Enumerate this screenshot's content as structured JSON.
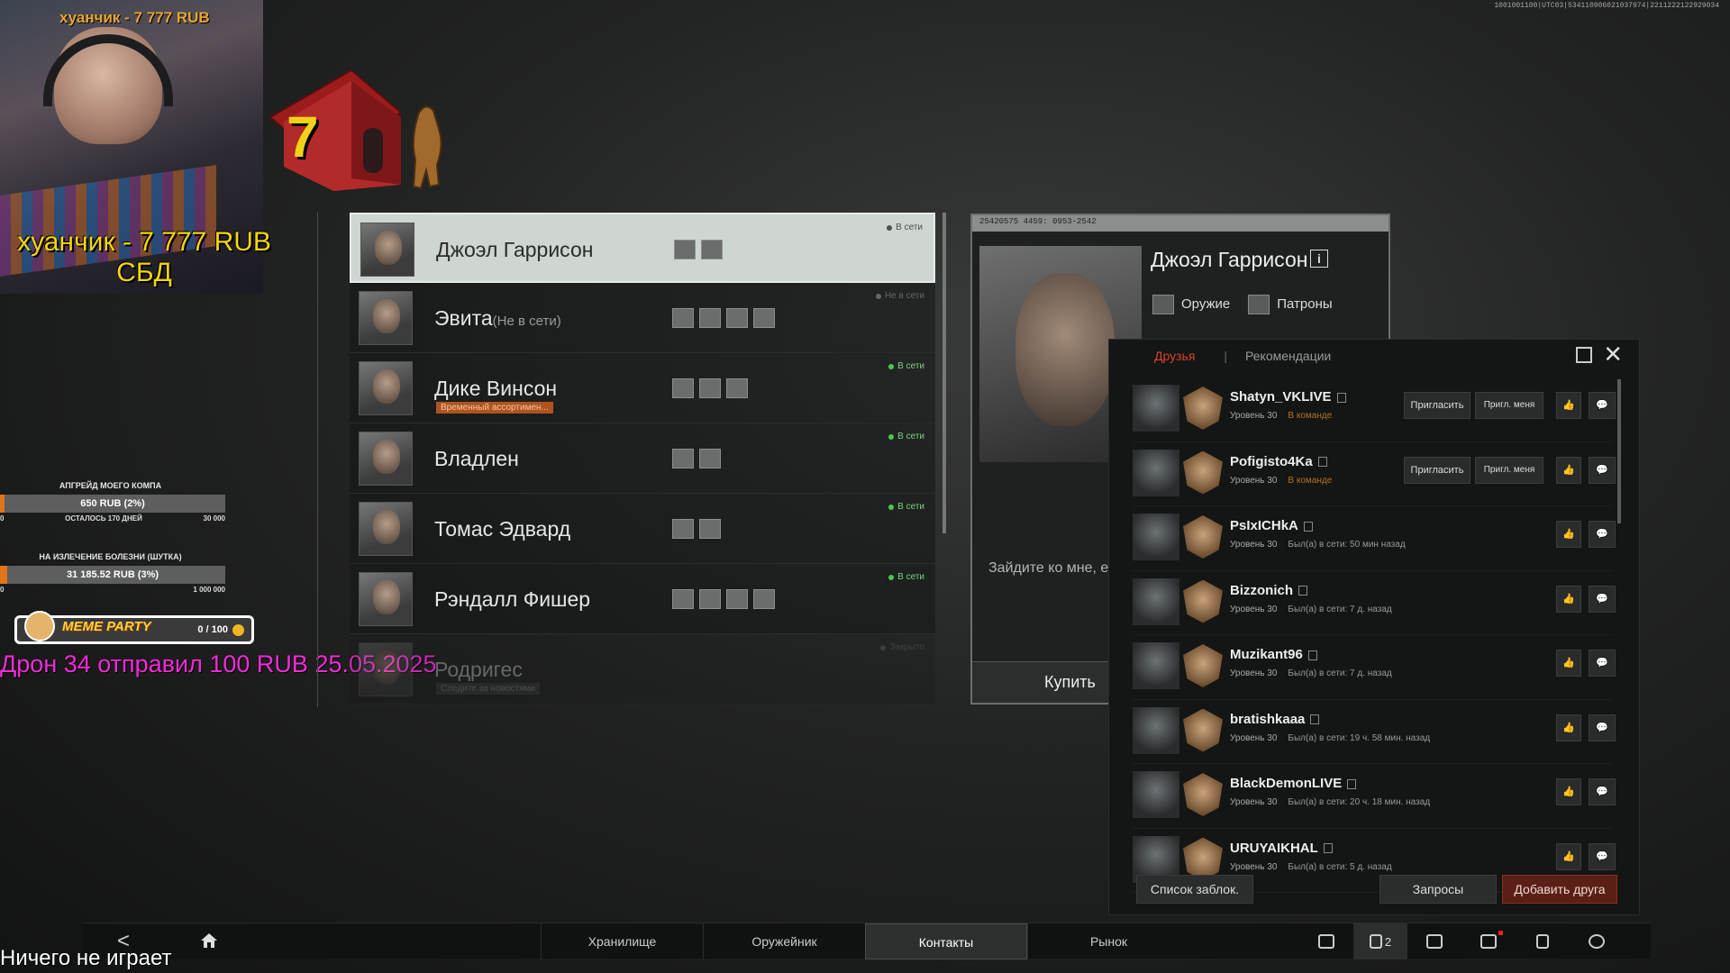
{
  "overlay": {
    "cam_caption": "хуанчик - 7 777 RUB",
    "donation_big_line1": "хуанчик - 7 777 RUB",
    "donation_big_line2": "СБД",
    "dog_count": "7",
    "debug_text": "1001001100|UTC03|534110906021037974|2211222122929034",
    "goal1": {
      "title": "АПГРЕЙД МОЕГО КОМПА",
      "value": "650 RUB (2%)",
      "fill_percent": 2,
      "left": "0",
      "mid": "ОСТАЛОСЬ 170 ДНЕЙ",
      "right": "30 000"
    },
    "goal2": {
      "title": "НА ИЗЛЕЧЕНИЕ БОЛЕЗНИ (ШУТКА)",
      "value": "31 185.52 RUB (3%)",
      "fill_percent": 3,
      "left": "0",
      "right": "1 000 000"
    },
    "meme": {
      "title": "MEME PARTY",
      "count": "0 / 100"
    },
    "drone_text": "Дрон 34 отправил 100 RUB 25.05.2025",
    "now_playing": "Ничего не играет"
  },
  "traders": [
    {
      "name": "Джоэл Гаррисон",
      "status": "",
      "badge": "",
      "online": "В сети",
      "icons": 2,
      "selected": true
    },
    {
      "name": "Эвита",
      "status": "(Не в сети)",
      "badge": "",
      "online": "Не в сети",
      "icons": 4,
      "offline": true
    },
    {
      "name": "Дике Винсон",
      "status": "",
      "badge": "Временный ассортимен...",
      "online": "В сети",
      "icons": 3
    },
    {
      "name": "Владлен",
      "status": "",
      "badge": "",
      "online": "В сети",
      "icons": 2
    },
    {
      "name": "Томас Эдвард",
      "status": "",
      "badge": "",
      "online": "В сети",
      "icons": 2
    },
    {
      "name": "Рэндалл Фишер",
      "status": "",
      "badge": "",
      "online": "В сети",
      "icons": 4
    },
    {
      "name": "Родригес",
      "status": "",
      "badge": "Следите за новостями",
      "online": "Закрыто",
      "icons": 0,
      "dim": true,
      "offline": true
    }
  ],
  "detail": {
    "topbar": "25420575 4459: 0953-2542",
    "name": "Джоэл Гаррисон",
    "info": "i",
    "tag1": "Оружие",
    "tag2": "Патроны",
    "phrase": "Зайдите ко мне, е... амуницией.",
    "buy": "Купить"
  },
  "friends": {
    "tab_friends": "Друзья",
    "tab_separator": "|",
    "tab_recommend": "Рекомендации",
    "close": "✕",
    "invite_label": "Пригласить",
    "invite_me_label": "Пригл. меня",
    "list": [
      {
        "name": "Shatyn_VKLIVE",
        "level": "Уровень 30",
        "status": "В команде",
        "team": true
      },
      {
        "name": "Pofigisto4Ka",
        "level": "Уровень 30",
        "status": "В команде",
        "team": true
      },
      {
        "name": "PsIxICHkA",
        "level": "Уровень 30",
        "status": "Был(а) в сети: 50 мин назад"
      },
      {
        "name": "Bizzonich",
        "level": "Уровень 30",
        "status": "Был(а) в сети: 7 д. назад"
      },
      {
        "name": "Muzikant96",
        "level": "Уровень 30",
        "status": "Был(а) в сети: 7 д. назад"
      },
      {
        "name": "bratishkaaa",
        "level": "Уровень 30",
        "status": "Был(а) в сети: 19 ч. 58 мин. назад"
      },
      {
        "name": "BlackDemonLIVE",
        "level": "Уровень 30",
        "status": "Был(а) в сети: 20 ч. 18 мин. назад"
      },
      {
        "name": "URUYAIKHAL",
        "level": "Уровень 30",
        "status": "Был(а) в сети: 5 д. назад"
      }
    ],
    "blocklist": "Список заблок.",
    "requests": "Запросы",
    "add_friend": "Добавить друга"
  },
  "nav": {
    "back": "<",
    "tabs": [
      "Хранилище",
      "Оружейник",
      "Контакты",
      "Рынок"
    ],
    "active_tab": 2,
    "friends_count": "2"
  },
  "colors": {
    "accent": "#d8442c",
    "online": "#48c84f",
    "donation_yellow": "#f5d60b",
    "drone_pink": "#f42ad9"
  }
}
